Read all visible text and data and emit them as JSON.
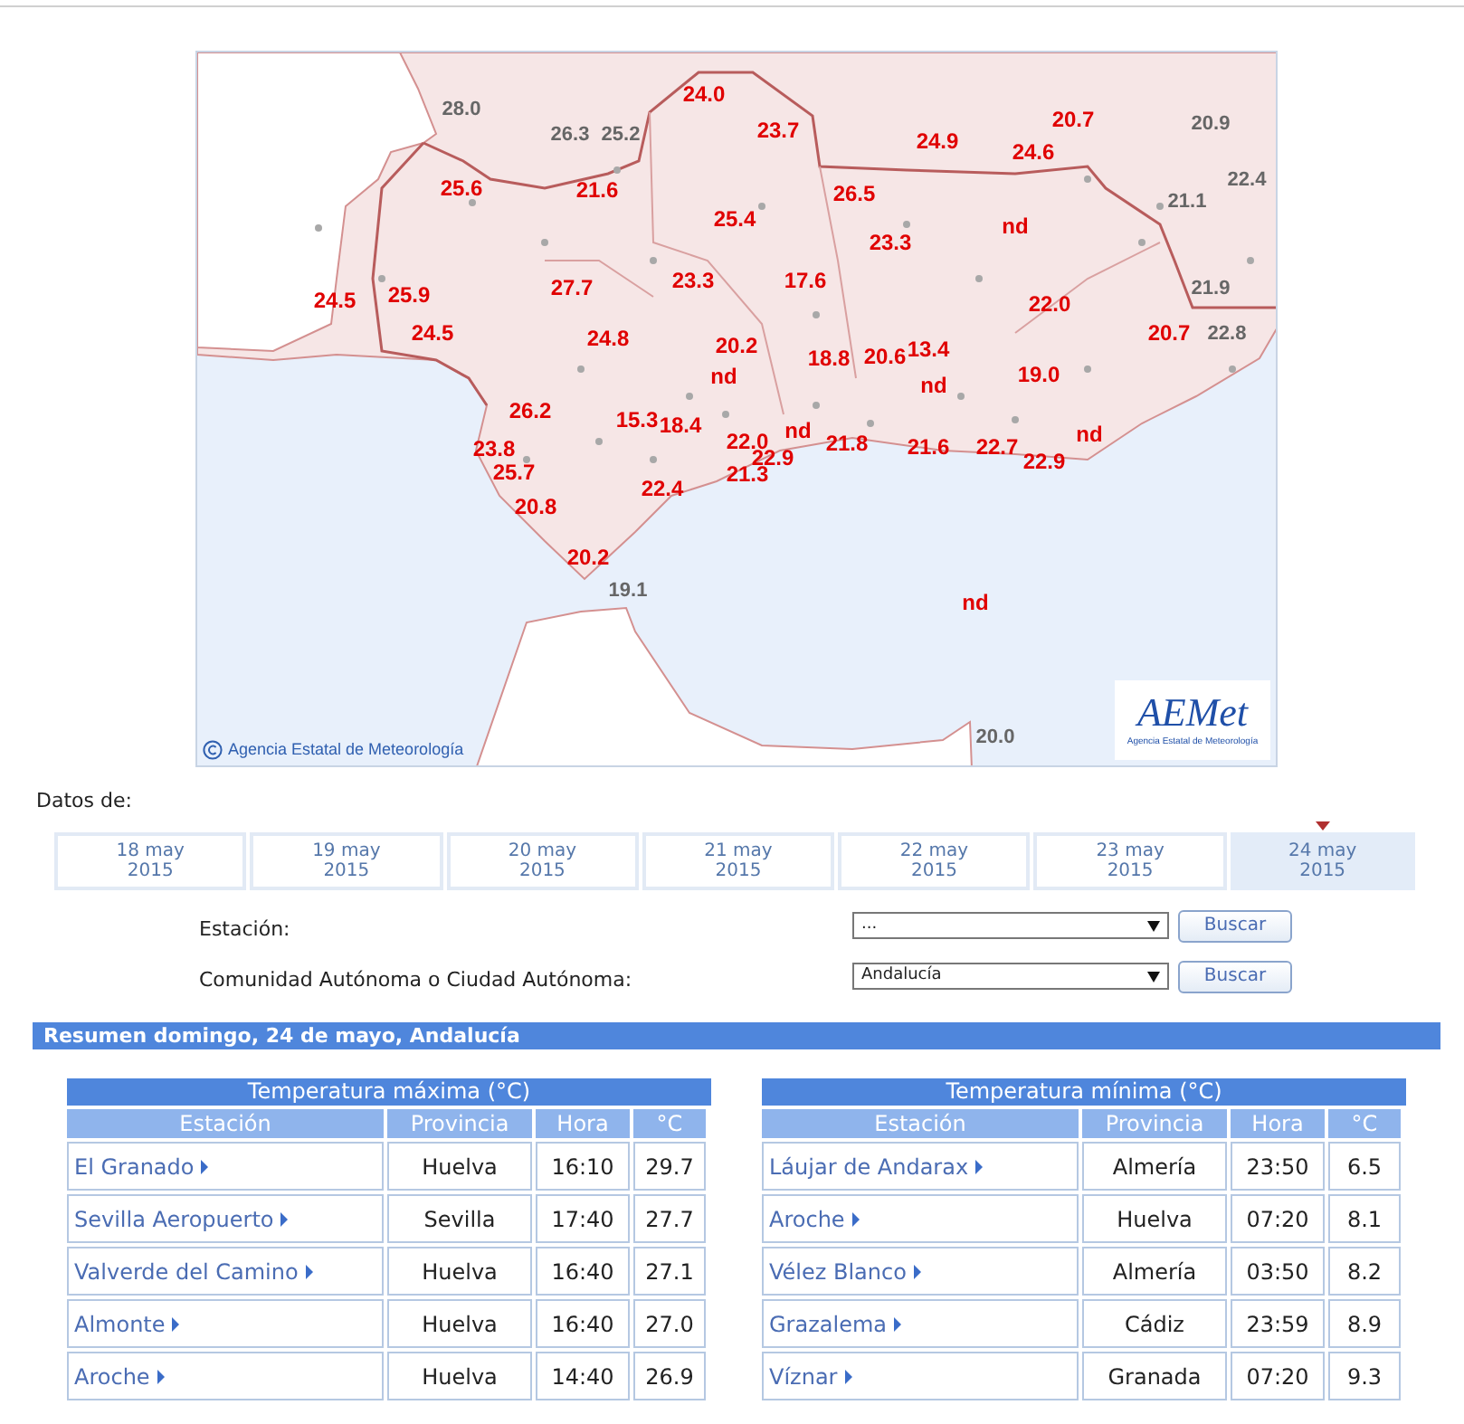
{
  "map": {
    "labels": [
      {
        "value": "24.0",
        "kind": "inside"
      },
      {
        "value": "28.0",
        "kind": "outside"
      },
      {
        "value": "26.3",
        "kind": "outside"
      },
      {
        "value": "25.2",
        "kind": "outside"
      },
      {
        "value": "23.7",
        "kind": "inside"
      },
      {
        "value": "24.9",
        "kind": "inside"
      },
      {
        "value": "20.7",
        "kind": "inside"
      },
      {
        "value": "20.9",
        "kind": "outside"
      },
      {
        "value": "24.6",
        "kind": "inside"
      },
      {
        "value": "22.4",
        "kind": "outside"
      },
      {
        "value": "25.6",
        "kind": "inside"
      },
      {
        "value": "21.6",
        "kind": "inside"
      },
      {
        "value": "26.5",
        "kind": "inside"
      },
      {
        "value": "21.1",
        "kind": "outside"
      },
      {
        "value": "25.4",
        "kind": "inside"
      },
      {
        "value": "nd",
        "kind": "inside"
      },
      {
        "value": "23.3",
        "kind": "inside"
      },
      {
        "value": "27.7",
        "kind": "inside"
      },
      {
        "value": "23.3",
        "kind": "inside"
      },
      {
        "value": "17.6",
        "kind": "inside"
      },
      {
        "value": "22.0",
        "kind": "inside"
      },
      {
        "value": "21.9",
        "kind": "outside"
      },
      {
        "value": "24.5",
        "kind": "inside"
      },
      {
        "value": "25.9",
        "kind": "inside"
      },
      {
        "value": "24.5",
        "kind": "inside"
      },
      {
        "value": "24.8",
        "kind": "inside"
      },
      {
        "value": "20.2",
        "kind": "inside"
      },
      {
        "value": "20.7",
        "kind": "inside"
      },
      {
        "value": "22.8",
        "kind": "outside"
      },
      {
        "value": "18.8",
        "kind": "inside"
      },
      {
        "value": "20.6",
        "kind": "inside"
      },
      {
        "value": "13.4",
        "kind": "inside"
      },
      {
        "value": "nd",
        "kind": "inside"
      },
      {
        "value": "nd",
        "kind": "inside"
      },
      {
        "value": "19.0",
        "kind": "inside"
      },
      {
        "value": "26.2",
        "kind": "inside"
      },
      {
        "value": "15.3",
        "kind": "inside"
      },
      {
        "value": "18.4",
        "kind": "inside"
      },
      {
        "value": "22.0",
        "kind": "inside"
      },
      {
        "value": "nd",
        "kind": "inside"
      },
      {
        "value": "21.8",
        "kind": "inside"
      },
      {
        "value": "21.6",
        "kind": "inside"
      },
      {
        "value": "22.7",
        "kind": "inside"
      },
      {
        "value": "nd",
        "kind": "inside"
      },
      {
        "value": "22.9",
        "kind": "inside"
      },
      {
        "value": "22.9",
        "kind": "inside"
      },
      {
        "value": "23.8",
        "kind": "inside"
      },
      {
        "value": "25.7",
        "kind": "inside"
      },
      {
        "value": "21.3",
        "kind": "inside"
      },
      {
        "value": "22.4",
        "kind": "inside"
      },
      {
        "value": "20.8",
        "kind": "inside"
      },
      {
        "value": "20.2",
        "kind": "inside"
      },
      {
        "value": "19.1",
        "kind": "outside"
      },
      {
        "value": "nd",
        "kind": "inside"
      },
      {
        "value": "20.0",
        "kind": "outside"
      }
    ],
    "attribution": "Agencia Estatal de Meteorología",
    "logo": {
      "name": "AEMet",
      "subtitle": "Agencia Estatal de Meteorología"
    }
  },
  "dates": {
    "label": "Datos de:",
    "items": [
      {
        "day": "18 may",
        "year": "2015",
        "selected": false
      },
      {
        "day": "19 may",
        "year": "2015",
        "selected": false
      },
      {
        "day": "20 may",
        "year": "2015",
        "selected": false
      },
      {
        "day": "21 may",
        "year": "2015",
        "selected": false
      },
      {
        "day": "22 may",
        "year": "2015",
        "selected": false
      },
      {
        "day": "23 may",
        "year": "2015",
        "selected": false
      },
      {
        "day": "24 may",
        "year": "2015",
        "selected": true
      }
    ]
  },
  "form": [
    {
      "label": "Estación:",
      "value": "...",
      "button": "Buscar"
    },
    {
      "label": "Comunidad Autónoma o Ciudad Autónoma:",
      "value": "Andalucía",
      "button": "Buscar"
    }
  ],
  "summary": {
    "title": "Resumen domingo, 24 de mayo, Andalucía",
    "tables": [
      {
        "title": "Temperatura máxima (°C)",
        "columns": [
          "Estación",
          "Provincia",
          "Hora",
          "°C"
        ],
        "rows": [
          {
            "station": "El Granado",
            "province": "Huelva",
            "time": "16:10",
            "temp": "29.7"
          },
          {
            "station": "Sevilla Aeropuerto",
            "province": "Sevilla",
            "time": "17:40",
            "temp": "27.7"
          },
          {
            "station": "Valverde del Camino",
            "province": "Huelva",
            "time": "16:40",
            "temp": "27.1"
          },
          {
            "station": "Almonte",
            "province": "Huelva",
            "time": "16:40",
            "temp": "27.0"
          },
          {
            "station": "Aroche",
            "province": "Huelva",
            "time": "14:40",
            "temp": "26.9"
          }
        ]
      },
      {
        "title": "Temperatura mínima (°C)",
        "columns": [
          "Estación",
          "Provincia",
          "Hora",
          "°C"
        ],
        "rows": [
          {
            "station": "Láujar de Andarax",
            "province": "Almería",
            "time": "23:50",
            "temp": "6.5"
          },
          {
            "station": "Aroche",
            "province": "Huelva",
            "time": "07:20",
            "temp": "8.1"
          },
          {
            "station": "Vélez Blanco",
            "province": "Almería",
            "time": "03:50",
            "temp": "8.2"
          },
          {
            "station": "Grazalema",
            "province": "Cádiz",
            "time": "23:59",
            "temp": "8.9"
          },
          {
            "station": "Víznar",
            "province": "Granada",
            "time": "07:20",
            "temp": "9.3"
          }
        ]
      }
    ]
  }
}
